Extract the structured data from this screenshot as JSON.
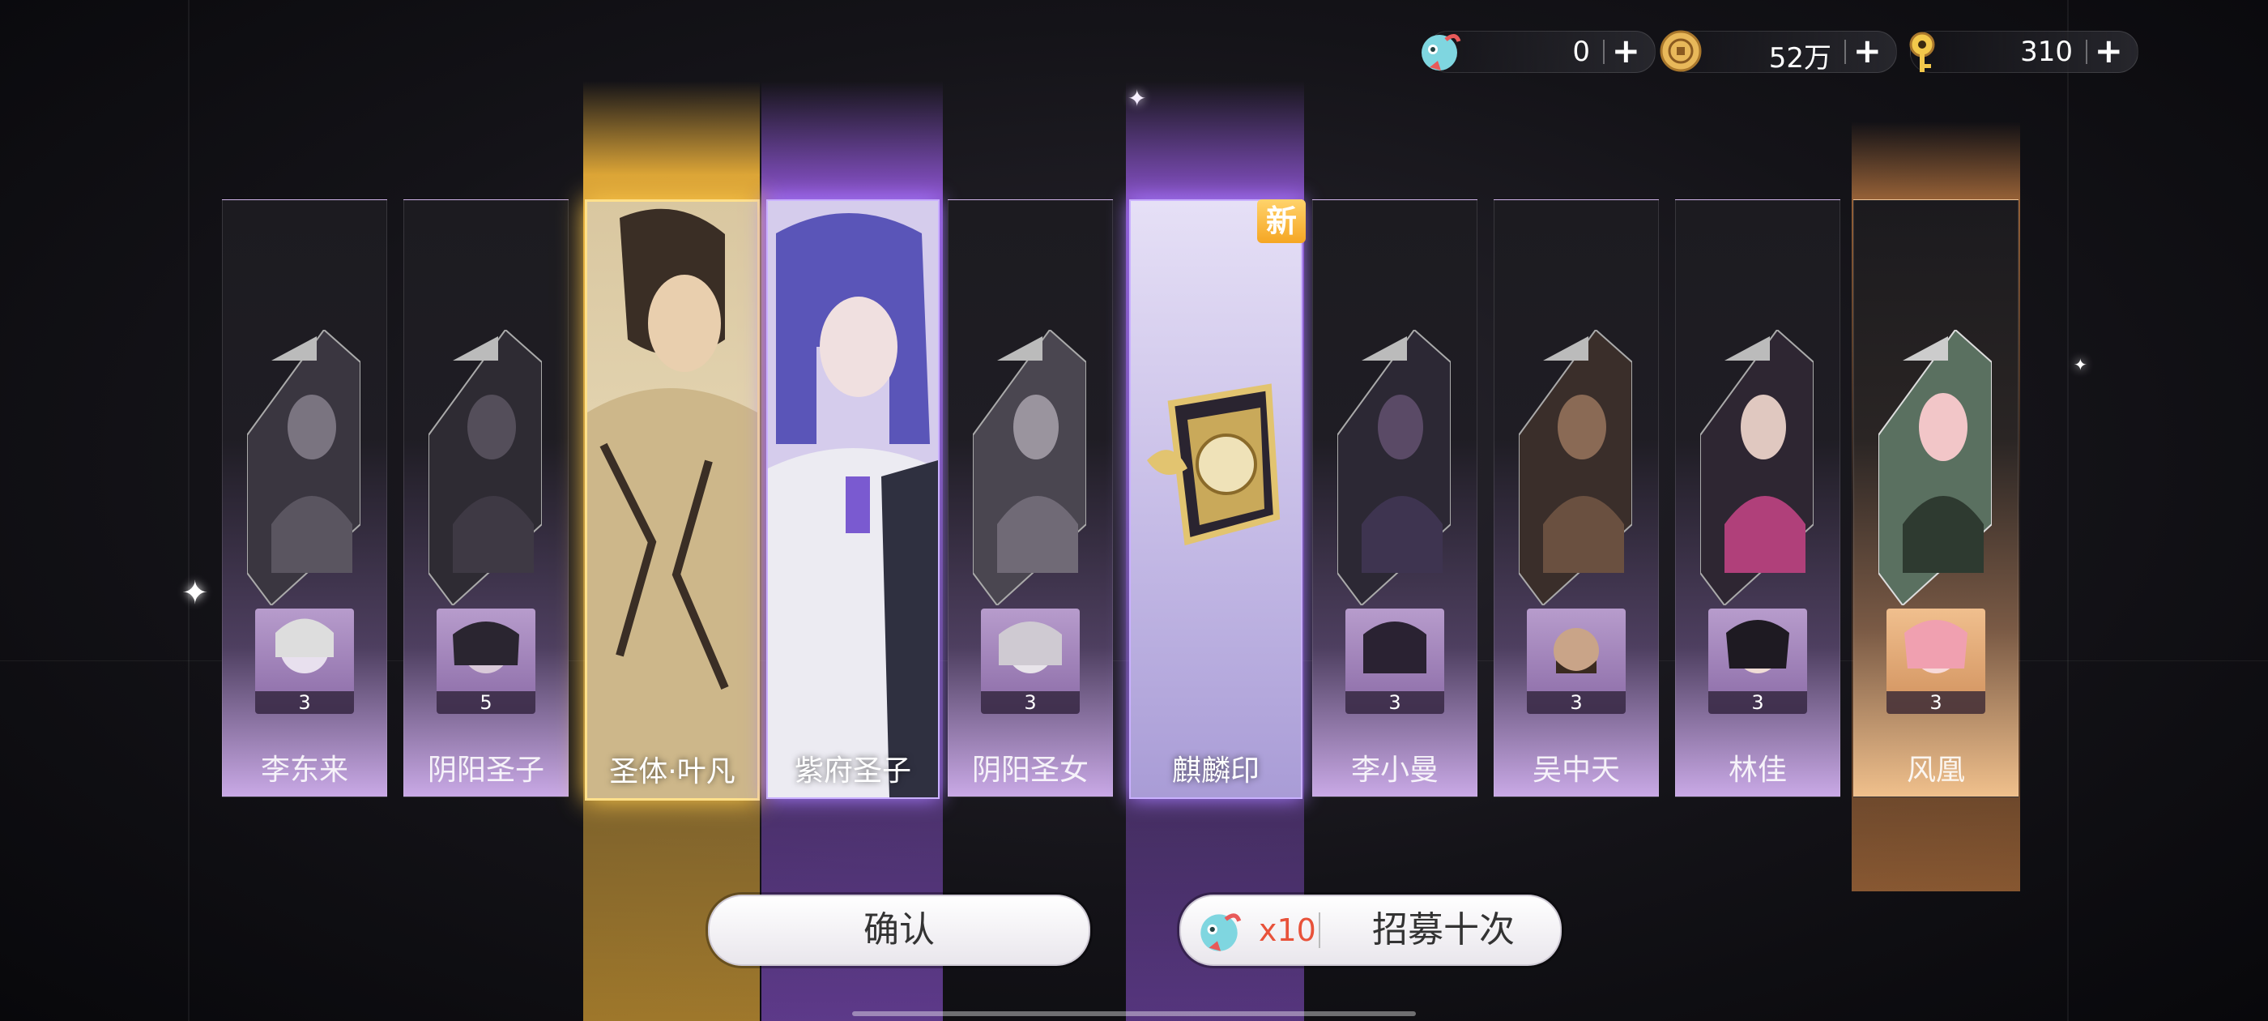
{
  "currency": [
    {
      "icon": "fish-token-icon",
      "value": "0"
    },
    {
      "icon": "gold-coin-icon",
      "value": "52万"
    },
    {
      "icon": "golden-key-icon",
      "value": "310"
    }
  ],
  "cards": [
    {
      "name": "李东来",
      "count": "3",
      "style": "purple"
    },
    {
      "name": "阴阳圣子",
      "count": "5",
      "style": "purple"
    },
    {
      "name": "圣体·叶凡",
      "count": "",
      "style": "gold-featured"
    },
    {
      "name": "紫府圣子",
      "count": "",
      "style": "purple-featured"
    },
    {
      "name": "阴阳圣女",
      "count": "3",
      "style": "purple"
    },
    {
      "name": "麒麟印",
      "count": "",
      "style": "item-featured",
      "badge": "新"
    },
    {
      "name": "李小曼",
      "count": "3",
      "style": "purple"
    },
    {
      "name": "吴中天",
      "count": "3",
      "style": "purple"
    },
    {
      "name": "林佳",
      "count": "3",
      "style": "purple"
    },
    {
      "name": "风凰",
      "count": "3",
      "style": "orange"
    }
  ],
  "buttons": {
    "confirm_label": "确认",
    "recruit_multiplier": "x10",
    "recruit_label": "招募十次"
  },
  "colors": {
    "gold": "#f5c542",
    "purple": "#b98cf0",
    "orange": "#f0a860",
    "cost_red": "#e8523a"
  }
}
